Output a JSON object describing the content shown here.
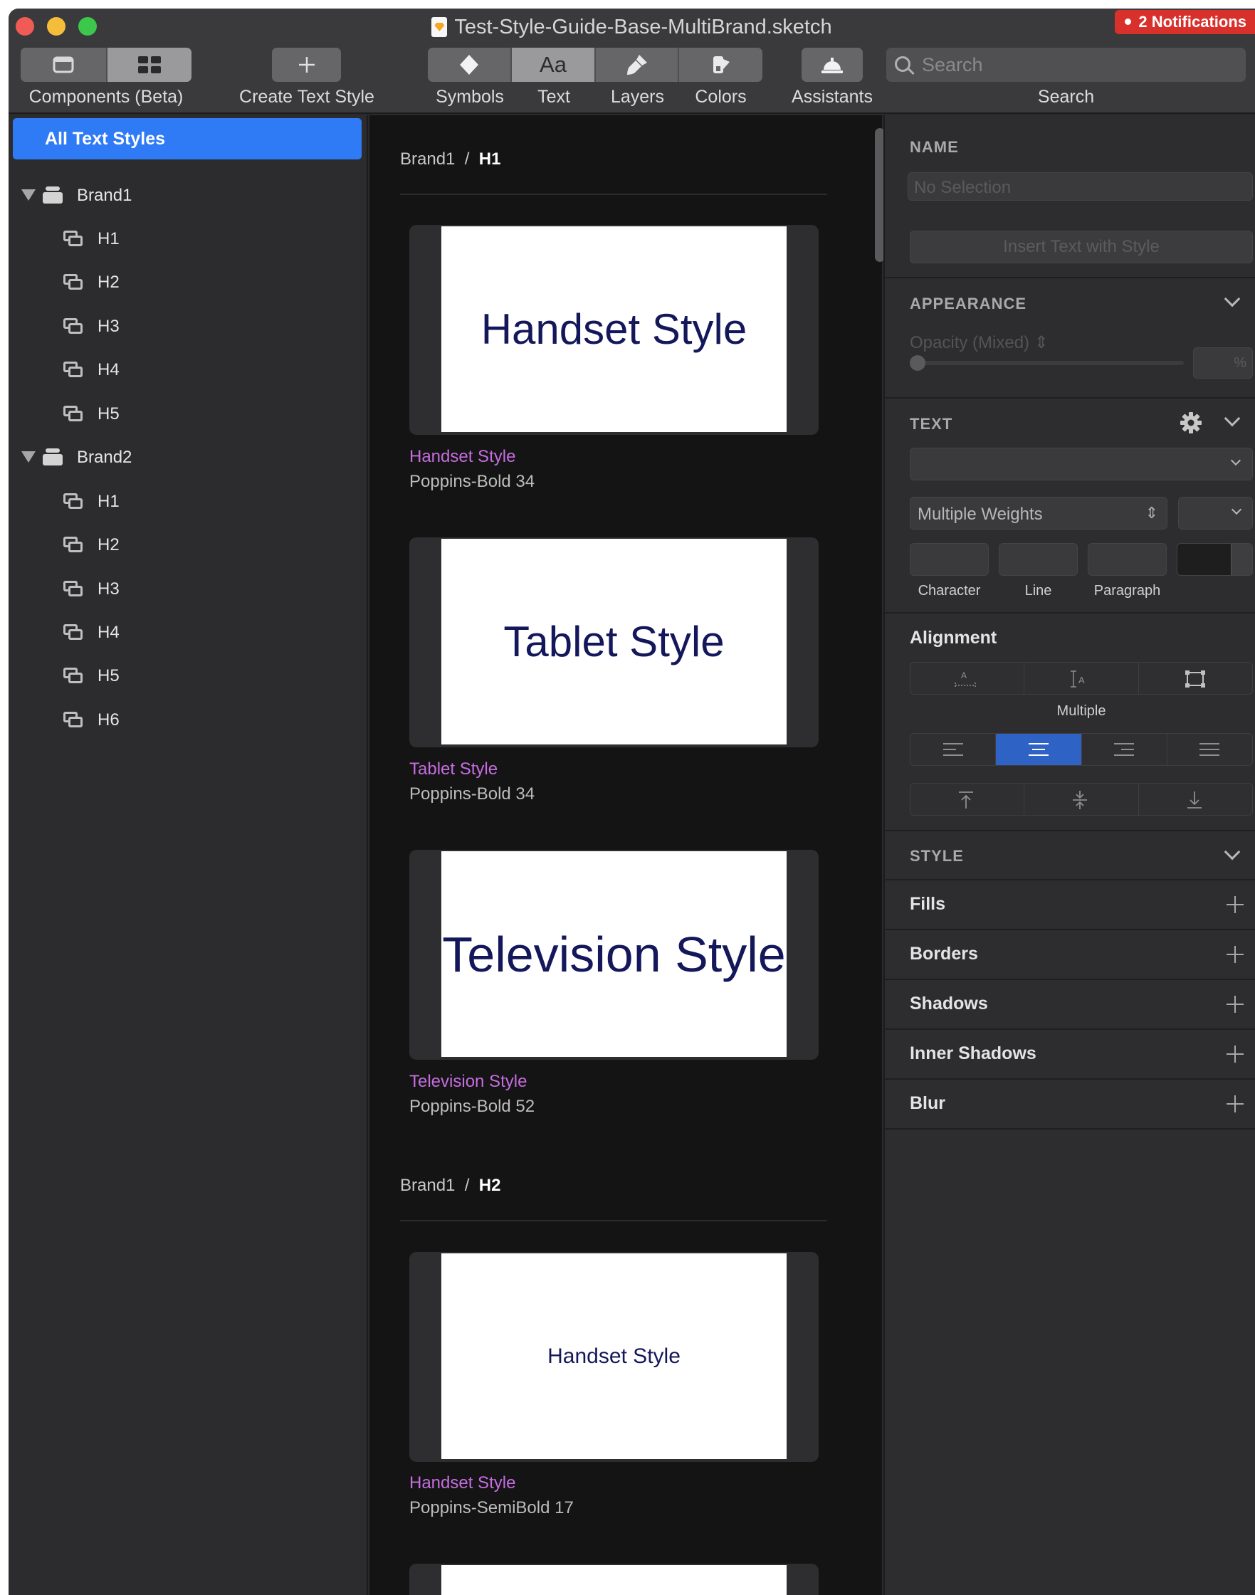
{
  "window": {
    "title": "Test-Style-Guide-Base-MultiBrand.sketch",
    "notifications": "2 Notifications"
  },
  "toolbar": {
    "components_label": "Components (Beta)",
    "create_text_style_label": "Create Text Style",
    "symbols_label": "Symbols",
    "text_label": "Text",
    "text_glyph": "Aa",
    "layers_label": "Layers",
    "colors_label": "Colors",
    "assistants_label": "Assistants",
    "search_placeholder": "Search",
    "search_label": "Search"
  },
  "sidebar": {
    "all_label": "All Text Styles",
    "groups": [
      {
        "label": "Brand1",
        "items": [
          "H1",
          "H2",
          "H3",
          "H4",
          "H5"
        ]
      },
      {
        "label": "Brand2",
        "items": [
          "H1",
          "H2",
          "H3",
          "H4",
          "H5",
          "H6"
        ]
      }
    ]
  },
  "list": {
    "sections": [
      {
        "crumb_parent": "Brand1",
        "crumb_sep": "/",
        "crumb_current": "H1",
        "cards": [
          {
            "preview": "Handset Style",
            "name": "Handset Style",
            "font": "Poppins-Bold 34"
          },
          {
            "preview": "Tablet Style",
            "name": "Tablet Style",
            "font": "Poppins-Bold 34"
          },
          {
            "preview": "Television Style",
            "name": "Television Style",
            "font": "Poppins-Bold 52"
          }
        ]
      },
      {
        "crumb_parent": "Brand1",
        "crumb_sep": "/",
        "crumb_current": "H2",
        "cards": [
          {
            "preview": "Handset Style",
            "name": "Handset Style",
            "font": "Poppins-SemiBold 17"
          }
        ]
      }
    ]
  },
  "inspector": {
    "name_header": "NAME",
    "name_placeholder": "No Selection",
    "insert_button": "Insert Text with Style",
    "appearance_header": "APPEARANCE",
    "opacity_label": "Opacity (Mixed)",
    "opacity_unit": "%",
    "text_header": "TEXT",
    "weight_value": "Multiple Weights",
    "spacing_labels": [
      "Character",
      "Line",
      "Paragraph"
    ],
    "alignment_label": "Alignment",
    "alignment_mode": "Multiple",
    "style_header": "STYLE",
    "style_rows": [
      "Fills",
      "Borders",
      "Shadows",
      "Inner Shadows",
      "Blur"
    ]
  },
  "colors": {
    "accent": "#2f7bf6",
    "notification": "#d8312c",
    "style_name": "#c66de0",
    "preview_text": "#14185a"
  }
}
